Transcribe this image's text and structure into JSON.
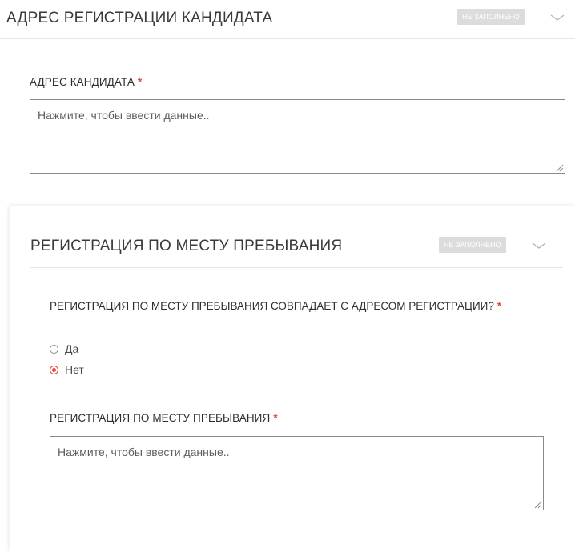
{
  "section_address": {
    "title": "АДРЕС РЕГИСТРАЦИИ КАНДИДАТА",
    "status": "НЕ ЗАПОЛНЕНО",
    "chevron_icon": "chevron-down-icon",
    "field": {
      "label": "АДРЕС КАНДИДАТА",
      "required_mark": "*",
      "placeholder": "Нажмите, чтобы ввести данные.."
    }
  },
  "section_stay": {
    "title": "РЕГИСТРАЦИЯ ПО МЕСТУ ПРЕБЫВАНИЯ",
    "status": "НЕ ЗАПОЛНЕНО",
    "chevron_icon": "chevron-down-icon",
    "question": {
      "label": "РЕГИСТРАЦИЯ ПО МЕСТУ ПРЕБЫВАНИЯ СОВПАДАЕТ С АДРЕСОМ РЕГИСТРАЦИИ?",
      "required_mark": "*",
      "options": [
        {
          "label": "Да",
          "selected": false
        },
        {
          "label": "Нет",
          "selected": true
        }
      ]
    },
    "field": {
      "label": "РЕГИСТРАЦИЯ ПО МЕСТУ ПРЕБЫВАНИЯ",
      "required_mark": "*",
      "placeholder": "Нажмите, чтобы ввести данные.."
    }
  },
  "colors": {
    "required": "#e8453c",
    "badge_bg": "#dcdcdc",
    "radio_selected": "#e8453c"
  }
}
